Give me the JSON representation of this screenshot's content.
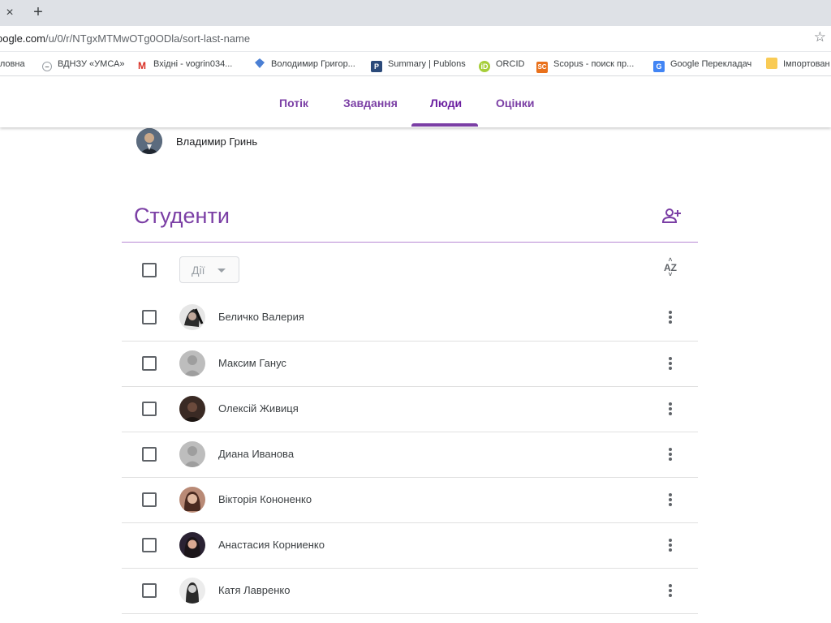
{
  "browser": {
    "new_tab": "+",
    "close_tab": "×",
    "url_host": "oogle.com",
    "url_path": "/u/0/r/NTgxMTMwOTg0ODla/sort-last-name",
    "bookmarks": [
      {
        "label": "оловна",
        "icon": "home-icon"
      },
      {
        "label": "ВДНЗУ «УМСА»",
        "icon": "globe-icon"
      },
      {
        "label": "Вхідні - vogrin034...",
        "icon": "gmail-icon"
      },
      {
        "label": "Володимир Григор...",
        "icon": "diamond-icon"
      },
      {
        "label": "Summary | Publons",
        "icon": "publons-icon"
      },
      {
        "label": "ORCID",
        "icon": "orcid-icon"
      },
      {
        "label": "Scopus - поиск пр...",
        "icon": "scopus-icon"
      },
      {
        "label": "Google Перекладач",
        "icon": "translate-icon"
      },
      {
        "label": "Імпортован",
        "icon": "folder-icon"
      }
    ]
  },
  "classroom": {
    "tabs": [
      {
        "label": "Потік",
        "active": false
      },
      {
        "label": "Завдання",
        "active": false
      },
      {
        "label": "Люди",
        "active": true
      },
      {
        "label": "Оцінки",
        "active": false
      }
    ],
    "accent_color": "#7b3fa5",
    "teacher": {
      "name": "Владимир Гринь"
    },
    "students_title": "Студенти",
    "actions_label": "Дії",
    "sort_label": "AZ",
    "students": [
      {
        "name": "Беличко Валерия",
        "avatar": "photo"
      },
      {
        "name": "Максим Ганус",
        "avatar": "default"
      },
      {
        "name": "Олексій Живиця",
        "avatar": "photo"
      },
      {
        "name": "Диана Иванова",
        "avatar": "default"
      },
      {
        "name": "Вікторія Кононенко",
        "avatar": "photo"
      },
      {
        "name": "Анастасия Корниенко",
        "avatar": "photo"
      },
      {
        "name": "Катя Лавренко",
        "avatar": "photo"
      }
    ]
  }
}
